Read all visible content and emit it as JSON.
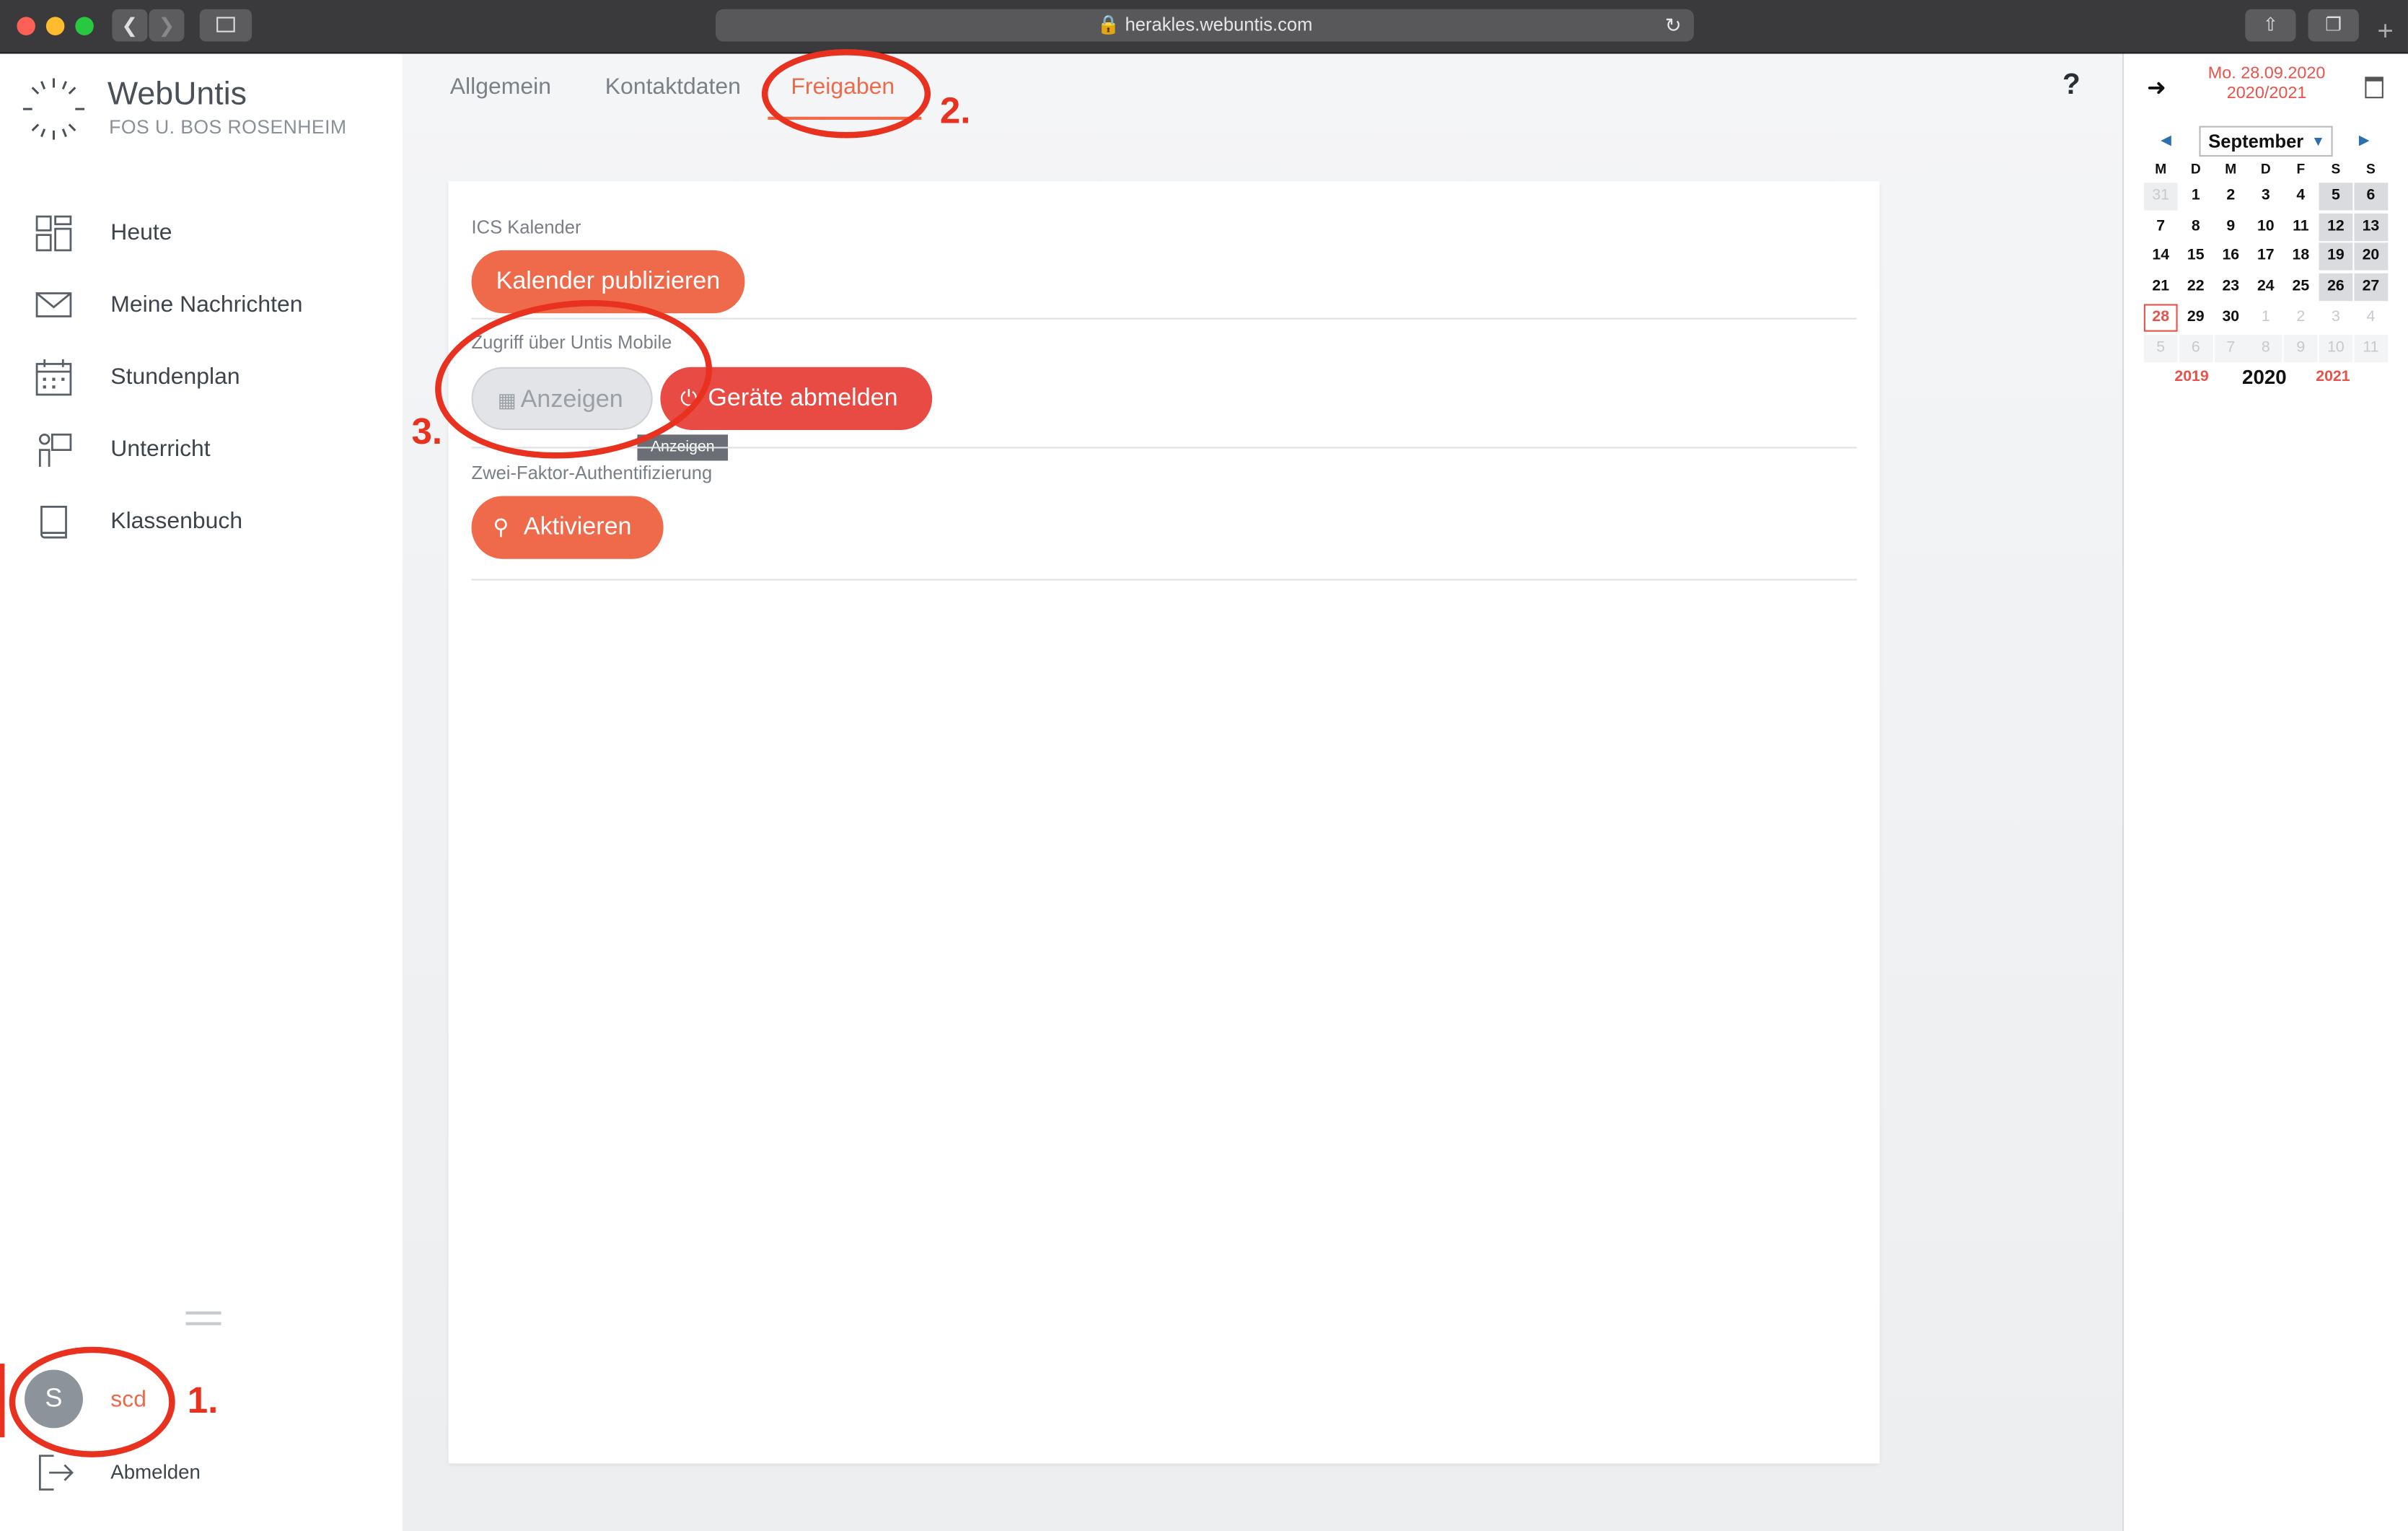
{
  "browser": {
    "url": "herakles.webuntis.com"
  },
  "app": {
    "title": "WebUntis",
    "school": "FOS U. BOS ROSENHEIM"
  },
  "nav": {
    "items": [
      {
        "label": "Heute",
        "icon": "dashboard-icon"
      },
      {
        "label": "Meine Nachrichten",
        "icon": "mail-icon"
      },
      {
        "label": "Stundenplan",
        "icon": "calendar-icon"
      },
      {
        "label": "Unterricht",
        "icon": "teacher-icon"
      },
      {
        "label": "Klassenbuch",
        "icon": "book-icon"
      }
    ]
  },
  "user": {
    "initial": "S",
    "name": "scd",
    "logout": "Abmelden"
  },
  "tabs": {
    "allgemein": "Allgemein",
    "kontakt": "Kontaktdaten",
    "freigaben": "Freigaben"
  },
  "help": "?",
  "sections": {
    "ics": {
      "title": "ICS Kalender",
      "button": "Kalender publizieren"
    },
    "mobile": {
      "title": "Zugriff über Untis Mobile",
      "show": "Anzeigen",
      "logout_devices": "Geräte abmelden",
      "tooltip": "Anzeigen"
    },
    "twofa": {
      "title": "Zwei-Faktor-Authentifizierung",
      "button": "Aktivieren"
    }
  },
  "annotations": {
    "a1": "1.",
    "a2": "2.",
    "a3": "3."
  },
  "calendar": {
    "date": "Mo. 28.09.2020",
    "schoolyear": "2020/2021",
    "month": "September",
    "weekdays": [
      "M",
      "D",
      "M",
      "D",
      "F",
      "S",
      "S"
    ],
    "weeks": [
      [
        "31",
        "1",
        "2",
        "3",
        "4",
        "5",
        "6"
      ],
      [
        "7",
        "8",
        "9",
        "10",
        "11",
        "12",
        "13"
      ],
      [
        "14",
        "15",
        "16",
        "17",
        "18",
        "19",
        "20"
      ],
      [
        "21",
        "22",
        "23",
        "24",
        "25",
        "26",
        "27"
      ],
      [
        "28",
        "29",
        "30",
        "1",
        "2",
        "3",
        "4"
      ],
      [
        "5",
        "6",
        "7",
        "8",
        "9",
        "10",
        "11"
      ]
    ],
    "years": {
      "prev": "2019",
      "current": "2020",
      "next": "2021"
    }
  },
  "colors": {
    "accent": "#ee6a4b",
    "danger": "#e84a44",
    "annotation": "#e8321f"
  }
}
